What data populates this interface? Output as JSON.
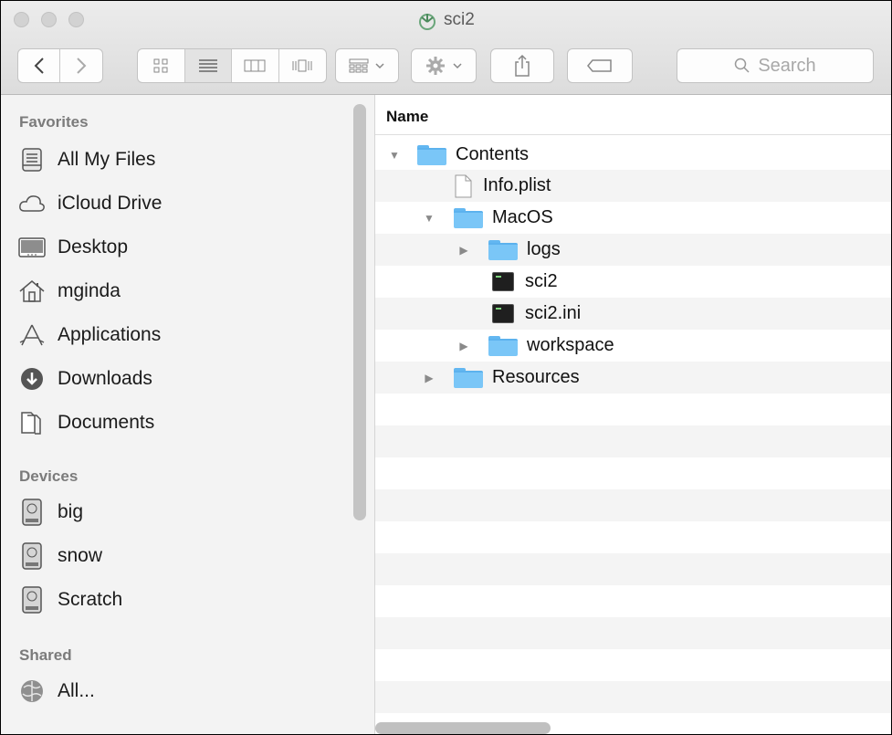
{
  "window": {
    "title": "sci2"
  },
  "toolbar": {
    "search_placeholder": "Search"
  },
  "sidebar": {
    "favorites_title": "Favorites",
    "devices_title": "Devices",
    "shared_title": "Shared",
    "favorites": [
      {
        "label": "All My Files",
        "icon": "all-files-icon"
      },
      {
        "label": "iCloud Drive",
        "icon": "cloud-icon"
      },
      {
        "label": "Desktop",
        "icon": "desktop-icon"
      },
      {
        "label": "mginda",
        "icon": "home-icon"
      },
      {
        "label": "Applications",
        "icon": "applications-icon"
      },
      {
        "label": "Downloads",
        "icon": "downloads-icon"
      },
      {
        "label": "Documents",
        "icon": "documents-icon"
      }
    ],
    "devices": [
      {
        "label": "big",
        "icon": "disk-icon"
      },
      {
        "label": "snow",
        "icon": "disk-icon"
      },
      {
        "label": "Scratch",
        "icon": "disk-icon"
      }
    ],
    "shared": [
      {
        "label": "All...",
        "icon": "network-icon"
      }
    ]
  },
  "list": {
    "column_name": "Name",
    "rows": [
      {
        "name": "Contents",
        "kind": "folder",
        "expanded": true
      },
      {
        "name": "Info.plist",
        "kind": "file"
      },
      {
        "name": "MacOS",
        "kind": "folder",
        "expanded": true
      },
      {
        "name": "logs",
        "kind": "folder",
        "expanded": false
      },
      {
        "name": "sci2",
        "kind": "executable"
      },
      {
        "name": "sci2.ini",
        "kind": "executable"
      },
      {
        "name": "workspace",
        "kind": "folder",
        "expanded": false
      },
      {
        "name": "Resources",
        "kind": "folder",
        "expanded": false
      }
    ]
  }
}
